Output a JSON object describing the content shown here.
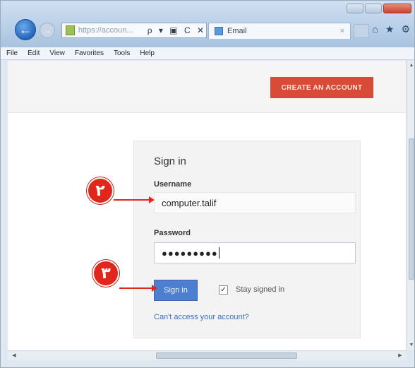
{
  "browser": {
    "address_text": "https://accoun...",
    "address_tools": "ρ ▾ ▣ C ✕",
    "tab_label": "Email",
    "tab_close": "×"
  },
  "menubar": {
    "items": [
      "File",
      "Edit",
      "View",
      "Favorites",
      "Tools",
      "Help"
    ]
  },
  "page": {
    "create_account_label": "CREATE AN ACCOUNT",
    "signin_title": "Sign in",
    "username_label": "Username",
    "username_value": "computer.talif",
    "password_label": "Password",
    "password_value": "●●●●●●●●●",
    "signin_button": "Sign in",
    "stay_signed_in": "Stay signed in",
    "stay_signed_in_checked": true,
    "cant_access": "Can't access your account?"
  },
  "markers": {
    "step_2": "۲",
    "step_3": "۳"
  },
  "icons": {
    "back": "back-arrow-icon",
    "forward": "forward-arrow-icon",
    "home": "home-icon",
    "favorites": "star-icon",
    "settings": "gear-icon"
  },
  "colors": {
    "create_button": "#d94a36",
    "signin_button": "#4d7fd0",
    "marker": "#e1261c",
    "link": "#3b6ec5"
  }
}
